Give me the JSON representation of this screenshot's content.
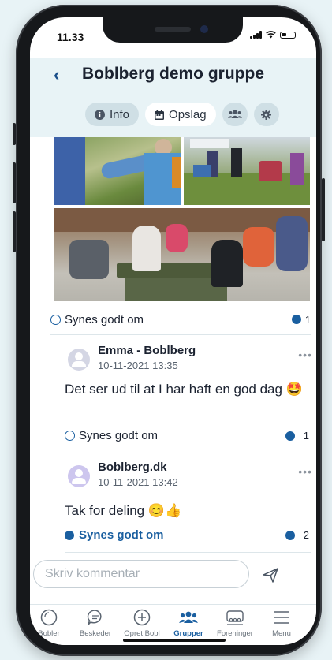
{
  "status_bar": {
    "time": "11.33"
  },
  "header": {
    "back_icon": "chevron-left-icon",
    "title": "Boblberg demo gruppe",
    "tabs": [
      {
        "label": "Info",
        "icon": "info-icon",
        "active": false
      },
      {
        "label": "Opslag",
        "icon": "calendar-icon",
        "active": true
      },
      {
        "label": "",
        "icon": "members-icon",
        "active": false
      },
      {
        "label": "",
        "icon": "gear-icon",
        "active": false
      }
    ]
  },
  "post": {
    "like_label": "Synes godt om",
    "like_count": "1"
  },
  "comments": [
    {
      "author": "Emma - Boblberg",
      "date": "10-11-2021 13:35",
      "text": "Det ser ud til at I har haft en god dag 🤩",
      "like_label": "Synes godt om",
      "like_count": "1",
      "liked": false
    },
    {
      "author": "Boblberg.dk",
      "date": "10-11-2021 13:42",
      "text": "Tak for deling 😊👍",
      "like_label": "Synes godt om",
      "like_count": "2",
      "liked": true
    }
  ],
  "comment_input": {
    "placeholder": "Skriv kommentar",
    "value": ""
  },
  "tabbar": {
    "items": [
      {
        "label": "Bobler",
        "icon": "bubble-icon"
      },
      {
        "label": "Beskeder",
        "icon": "chat-icon"
      },
      {
        "label": "Opret Bobl",
        "icon": "plus-circle-icon"
      },
      {
        "label": "Grupper",
        "icon": "group-icon",
        "active": true
      },
      {
        "label": "Foreninger",
        "icon": "associations-icon"
      },
      {
        "label": "Menu",
        "icon": "menu-icon"
      }
    ]
  },
  "colors": {
    "accent": "#1a5fa0",
    "header_bg": "#e8f3f6",
    "text": "#1b2230"
  }
}
